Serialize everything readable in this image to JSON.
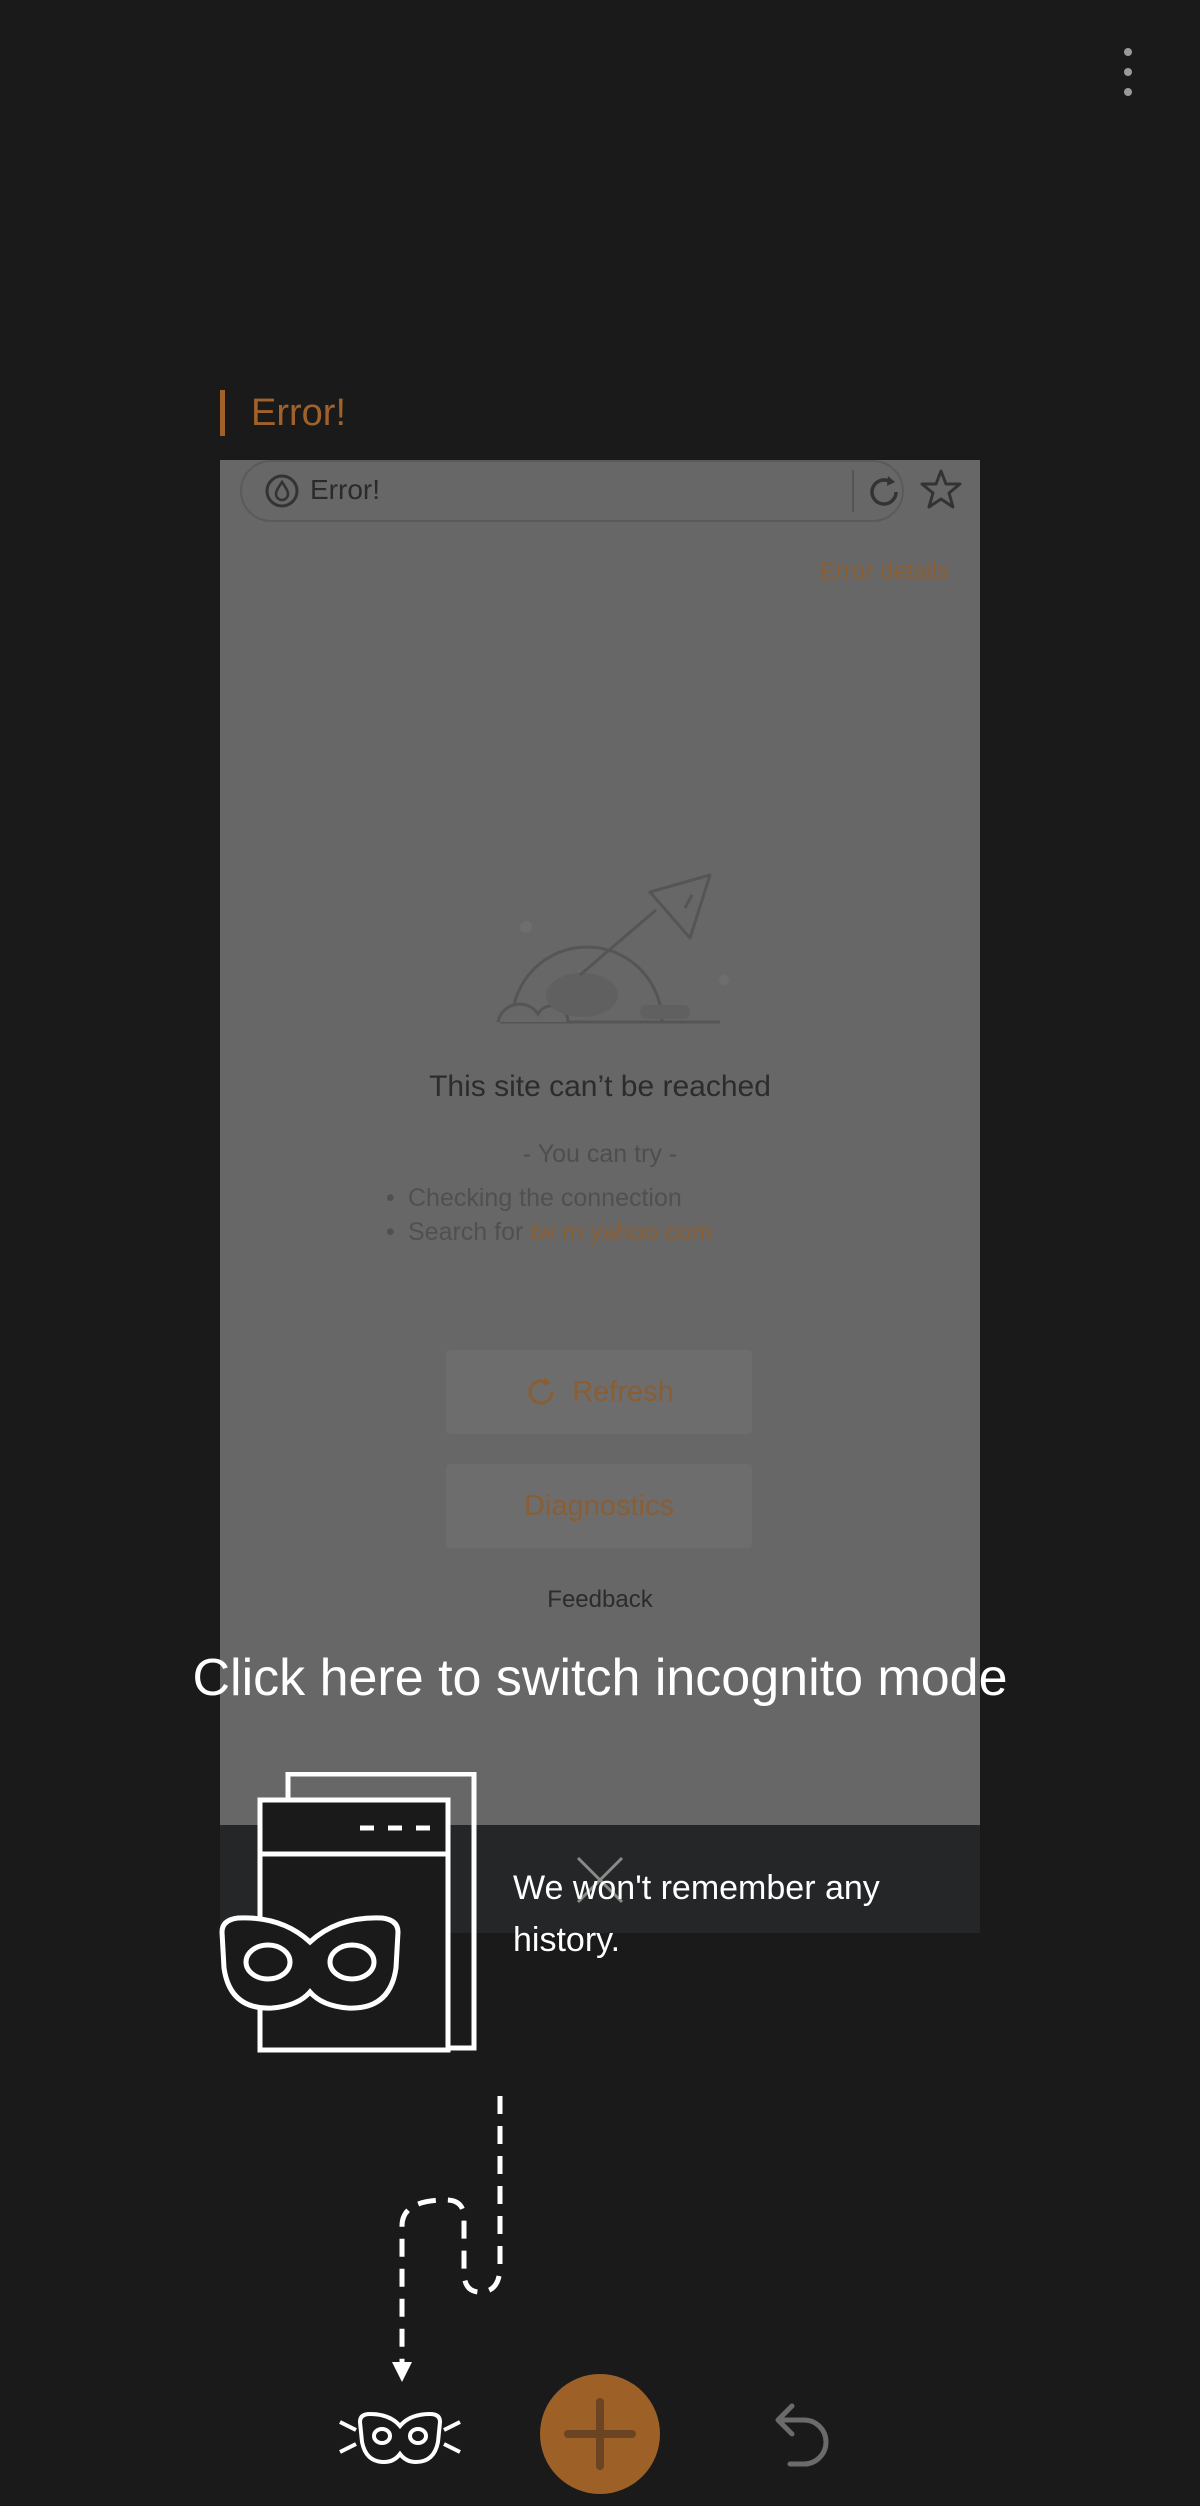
{
  "switcher": {
    "tab_title": "Error!",
    "menu_icon": "more-vert-icon"
  },
  "tab_preview": {
    "url_text": "Error!",
    "error_details": "Error details",
    "heading": "This site can’t be reached",
    "you_can_try": "- You can try -",
    "suggestions": {
      "item1": "Checking the connection",
      "item2_prefix": "Search for ",
      "item2_link": "tw m yahoo com"
    },
    "refresh_label": "Refresh",
    "diagnostics_label": "Diagnostics",
    "feedback_label": "Feedback"
  },
  "coach": {
    "title": "Click here to switch incognito mode",
    "description": "We won't remember any history."
  },
  "colors": {
    "accent": "#9d6128",
    "background": "#1a1a1b",
    "overlay_text": "#ffffff"
  },
  "icons": [
    "more-vert-icon",
    "info-icon",
    "refresh-icon",
    "star-icon",
    "close-icon",
    "incognito-mask-icon",
    "plus-icon",
    "undo-icon"
  ]
}
